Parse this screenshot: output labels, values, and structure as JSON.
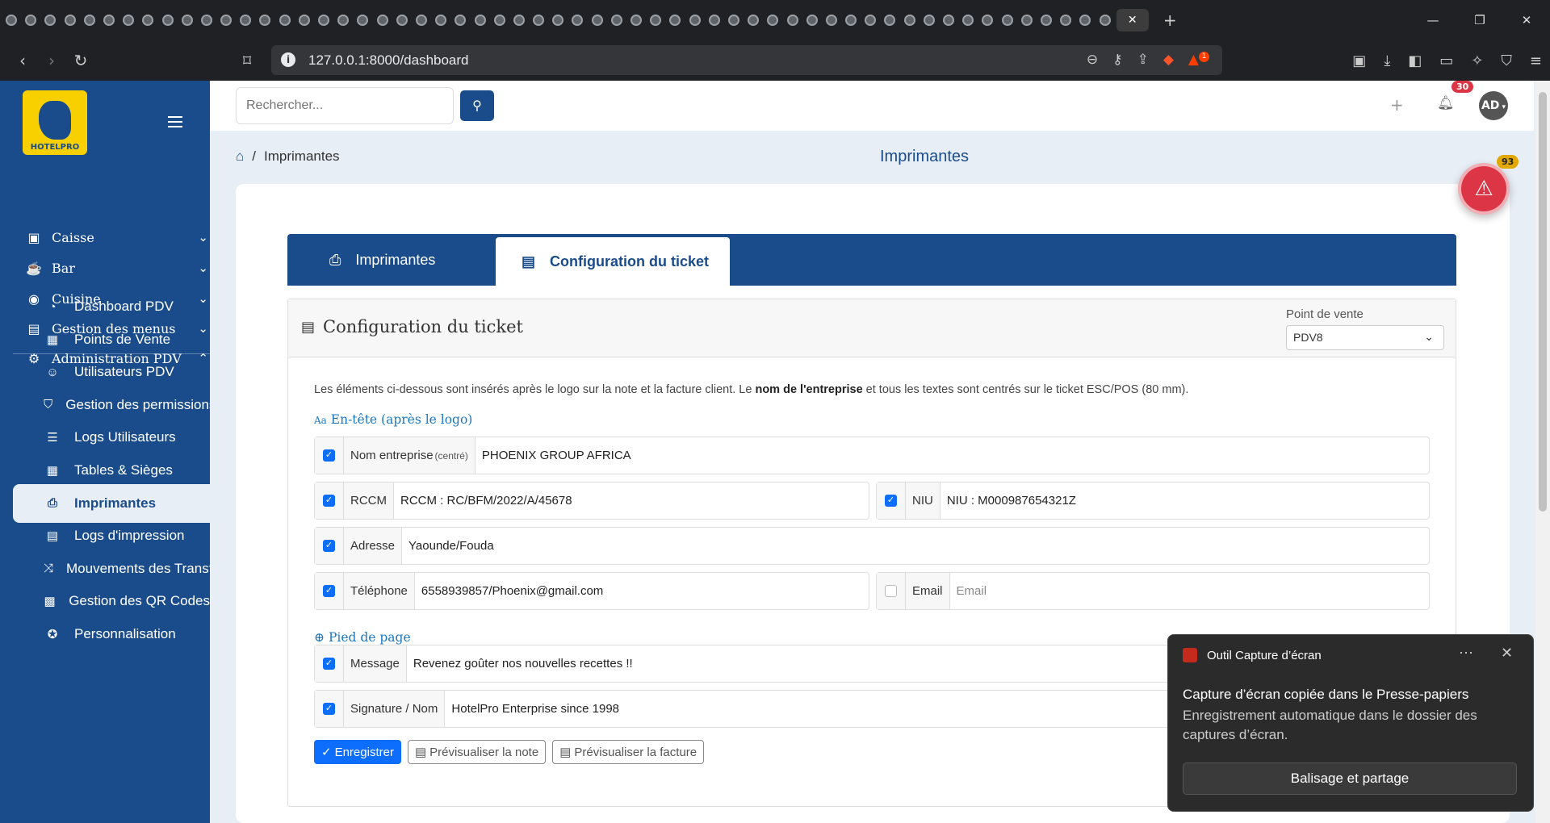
{
  "browser": {
    "tab_count": 57,
    "active_tab_close": "✕",
    "new_tab": "+",
    "url": "127.0.0.1:8000/dashboard",
    "brave_shield_count": "1",
    "window_controls": [
      "—",
      "❐",
      "✕"
    ]
  },
  "sidebar": {
    "logo_text": "HOTELPRO",
    "menu": [
      {
        "label": "Caisse",
        "icon": "cash-register-icon",
        "glyph": "▣",
        "chevron": "⌄"
      },
      {
        "label": "Bar",
        "icon": "cocktail-icon",
        "glyph": "☕",
        "chevron": "⌄"
      },
      {
        "label": "Cuisine",
        "icon": "kitchen-icon",
        "glyph": "◉",
        "chevron": "⌄"
      },
      {
        "label": "Gestion des menus",
        "icon": "book-icon",
        "glyph": "▤",
        "chevron": "⌄"
      },
      {
        "label": "Administration PDV",
        "icon": "gear-icon",
        "glyph": "⚙",
        "chevron": "⌃"
      }
    ],
    "sub_items": [
      {
        "label": "Dashboard PDV",
        "icon": "speedometer-icon",
        "glyph": "◔",
        "active": false
      },
      {
        "label": "Points de Vente",
        "icon": "building-icon",
        "glyph": "▦",
        "active": false
      },
      {
        "label": "Utilisateurs PDV",
        "icon": "users-icon",
        "glyph": "☺",
        "active": false
      },
      {
        "label": "Gestion des permissions",
        "icon": "shield-icon",
        "glyph": "⛉",
        "active": false
      },
      {
        "label": "Logs Utilisateurs",
        "icon": "list-icon",
        "glyph": "☰",
        "active": false
      },
      {
        "label": "Tables & Sièges",
        "icon": "table-icon",
        "glyph": "▦",
        "active": false
      },
      {
        "label": "Imprimantes",
        "icon": "printer-icon",
        "glyph": "⎙",
        "active": true
      },
      {
        "label": "Logs d'impression",
        "icon": "receipt-icon",
        "glyph": "▤",
        "active": false
      },
      {
        "label": "Mouvements des Transferts",
        "icon": "shuffle-icon",
        "glyph": "⤨",
        "active": false
      },
      {
        "label": "Gestion des QR Codes",
        "icon": "qr-code-icon",
        "glyph": "▩",
        "active": false
      },
      {
        "label": "Personnalisation",
        "icon": "palette-icon",
        "glyph": "✪",
        "active": false
      }
    ]
  },
  "topbar": {
    "search_placeholder": "Rechercher...",
    "plus": "+",
    "notifications_count": "30",
    "avatar_initials": "AD"
  },
  "page": {
    "breadcrumb": "Imprimantes",
    "breadcrumb_sep": "/",
    "title": "Imprimantes",
    "alert_count": "93"
  },
  "tabs": [
    {
      "label": "Imprimantes",
      "active": false
    },
    {
      "label": "Configuration du ticket",
      "active": true
    }
  ],
  "config": {
    "title": "Configuration du ticket",
    "pv_label": "Point de vente",
    "pv_value": "PDV8",
    "intro_a": "Les éléments ci-dessous sont insérés après le logo sur la note et la facture client. Le ",
    "intro_b": "nom de l'entreprise",
    "intro_c": " et tous les textes sont centrés sur le ticket ESC/POS (80 mm).",
    "header_section": "En-tête (après le logo)",
    "footer_section": "Pied de page",
    "fields": {
      "nom": {
        "label": "Nom entreprise",
        "suffix": "(centré)",
        "value": "PHOENIX GROUP AFRICA",
        "checked": true
      },
      "rccm": {
        "label": "RCCM",
        "value": "RCCM : RC/BFM/2022/A/45678",
        "checked": true
      },
      "niu": {
        "label": "NIU",
        "value": "NIU : M000987654321Z",
        "checked": true
      },
      "adresse": {
        "label": "Adresse",
        "value": "Yaounde/Fouda",
        "checked": true
      },
      "telephone": {
        "label": "Téléphone",
        "value": "6558939857/Phoenix@gmail.com",
        "checked": true
      },
      "email": {
        "label": "Email",
        "placeholder": "Email",
        "checked": false
      },
      "message": {
        "label": "Message",
        "value": "Revenez goûter nos nouvelles recettes !!",
        "checked": true
      },
      "signature": {
        "label": "Signature / Nom",
        "value": "HotelPro Enterprise since 1998",
        "checked": true
      }
    },
    "buttons": {
      "save": "Enregistrer",
      "preview_note": "Prévisualiser la note",
      "preview_invoice": "Prévisualiser la facture"
    }
  },
  "toast": {
    "app": "Outil Capture d’écran",
    "title": "Capture d’écran copiée dans le Presse-papiers",
    "body": "Enregistrement automatique dans le dossier des captures d’écran.",
    "button": "Balisage et partage"
  }
}
